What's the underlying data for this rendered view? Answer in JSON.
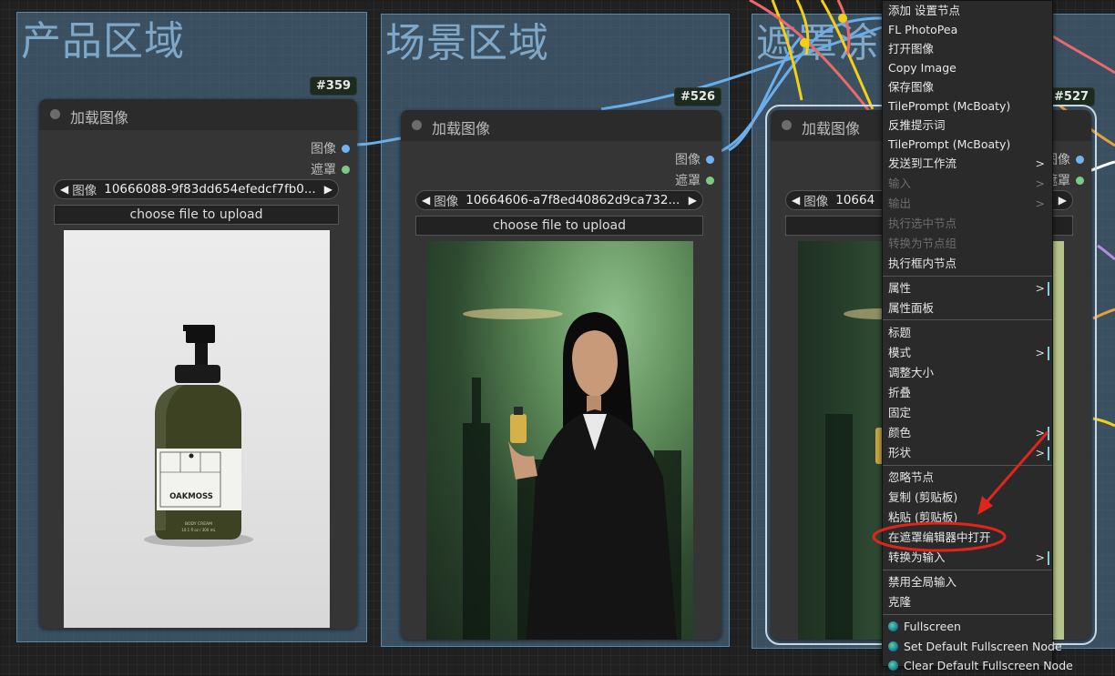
{
  "groups": [
    {
      "title": "产品区域"
    },
    {
      "title": "场景区域"
    },
    {
      "title": "遮罩涂"
    }
  ],
  "nodes": [
    {
      "id": "#359",
      "title": "加载图像",
      "outputs": [
        "图像",
        "遮罩"
      ],
      "image_widget_label": "图像",
      "image_value": "10666088-9f83dd654efedcf7fb0...",
      "upload_label": "choose file to upload",
      "preview": {
        "product_label": "OAKMOSS",
        "product_sub": "BODY CREAM",
        "product_size": "10.1 fl oz / 300 mL"
      }
    },
    {
      "id": "#526",
      "title": "加载图像",
      "outputs": [
        "图像",
        "遮罩"
      ],
      "image_widget_label": "图像",
      "image_value": "10664606-a7f8ed40862d9ca732...",
      "upload_label": "choose file to upload"
    },
    {
      "id": "#527",
      "title": "加载图像",
      "outputs": [
        "图像",
        "遮罩"
      ],
      "image_widget_label": "图像",
      "image_value": "10664",
      "upload_label": "ch"
    }
  ],
  "context_menu": {
    "items": [
      {
        "label": "添加 设置节点",
        "disabled": false,
        "submenu": false
      },
      {
        "label": "FL PhotoPea",
        "disabled": false,
        "submenu": false
      },
      {
        "label": "打开图像",
        "disabled": false,
        "submenu": false
      },
      {
        "label": "Copy Image",
        "disabled": false,
        "submenu": false
      },
      {
        "label": "保存图像",
        "disabled": false,
        "submenu": false
      },
      {
        "label": "TilePrompt (McBoaty)",
        "disabled": false,
        "submenu": false
      },
      {
        "label": "反推提示词",
        "disabled": false,
        "submenu": false
      },
      {
        "label": "TilePrompt (McBoaty)",
        "disabled": false,
        "submenu": false
      },
      {
        "label": "发送到工作流",
        "disabled": false,
        "submenu": true
      },
      {
        "label": "输入",
        "disabled": true,
        "submenu": true
      },
      {
        "label": "输出",
        "disabled": true,
        "submenu": true
      },
      {
        "label": "执行选中节点",
        "disabled": true,
        "submenu": false
      },
      {
        "label": "转换为节点组",
        "disabled": true,
        "submenu": false
      },
      {
        "label": "执行框内节点",
        "disabled": false,
        "submenu": false
      },
      {
        "separator": true
      },
      {
        "label": "属性",
        "disabled": false,
        "submenu": true
      },
      {
        "label": "属性面板",
        "disabled": false,
        "submenu": false
      },
      {
        "separator": true
      },
      {
        "label": "标题",
        "disabled": false,
        "submenu": false
      },
      {
        "label": "模式",
        "disabled": false,
        "submenu": true
      },
      {
        "label": "调整大小",
        "disabled": false,
        "submenu": false
      },
      {
        "label": "折叠",
        "disabled": false,
        "submenu": false
      },
      {
        "label": "固定",
        "disabled": false,
        "submenu": false
      },
      {
        "label": "颜色",
        "disabled": false,
        "submenu": true
      },
      {
        "label": "形状",
        "disabled": false,
        "submenu": true
      },
      {
        "separator": true
      },
      {
        "label": "忽略节点",
        "disabled": false,
        "submenu": false
      },
      {
        "label": "复制 (剪贴板)",
        "disabled": false,
        "submenu": false
      },
      {
        "label": "粘贴 (剪贴板)",
        "disabled": false,
        "submenu": false
      },
      {
        "label": "在遮罩编辑器中打开",
        "disabled": false,
        "submenu": false,
        "highlighted": true
      },
      {
        "label": "转换为输入",
        "disabled": false,
        "submenu": true
      },
      {
        "separator": true
      },
      {
        "label": "禁用全局输入",
        "disabled": false,
        "submenu": false
      },
      {
        "label": "克隆",
        "disabled": false,
        "submenu": false
      },
      {
        "separator": true
      },
      {
        "label": "Fullscreen",
        "disabled": false,
        "submenu": false,
        "icon": "globe-icon"
      },
      {
        "label": "Set Default Fullscreen Node",
        "disabled": false,
        "submenu": false,
        "icon": "globe-icon"
      },
      {
        "label": "Clear Default Fullscreen Node",
        "disabled": false,
        "submenu": false,
        "icon": "globe-icon"
      }
    ]
  },
  "colors": {
    "port_image": "#6fb3f0",
    "port_mask": "#7ec98a",
    "wire_blue": "#6aaeea",
    "wire_yellow": "#f2d017",
    "wire_red": "#e86a6a",
    "wire_orange": "#e8a03a",
    "annotation_red": "#e0251c",
    "group_fill": "#4f7696"
  }
}
